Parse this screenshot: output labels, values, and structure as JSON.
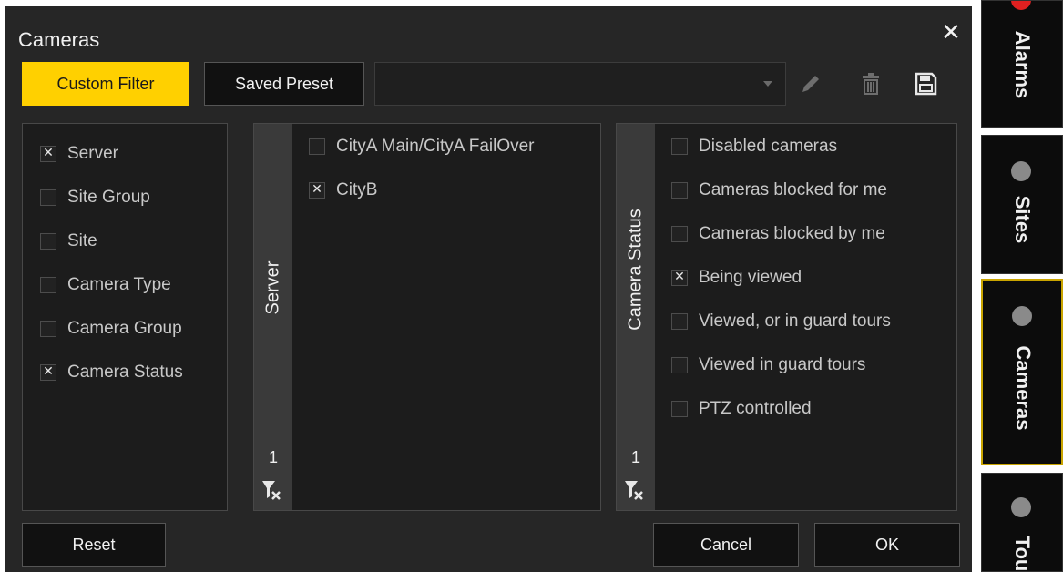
{
  "dialog": {
    "title": "Cameras",
    "close_glyph": "✕",
    "tabs": {
      "custom_filter": "Custom Filter",
      "saved_preset": "Saved Preset"
    },
    "preset_value": "",
    "icons": [
      "pencil-icon",
      "trash-icon",
      "save-icon"
    ]
  },
  "categories": [
    {
      "label": "Server",
      "checked": true
    },
    {
      "label": "Site Group",
      "checked": false
    },
    {
      "label": "Site",
      "checked": false
    },
    {
      "label": "Camera Type",
      "checked": false
    },
    {
      "label": "Camera Group",
      "checked": false
    },
    {
      "label": "Camera Status",
      "checked": true
    }
  ],
  "server_panel": {
    "title": "Server",
    "count": "1",
    "items": [
      {
        "label": "CityA Main/CityA FailOver",
        "checked": false
      },
      {
        "label": "CityB",
        "checked": true
      }
    ]
  },
  "status_panel": {
    "title": "Camera Status",
    "count": "1",
    "items": [
      {
        "label": "Disabled cameras",
        "checked": false
      },
      {
        "label": "Cameras blocked for me",
        "checked": false
      },
      {
        "label": "Cameras blocked by me",
        "checked": false
      },
      {
        "label": "Being viewed",
        "checked": true
      },
      {
        "label": "Viewed, or in guard tours",
        "checked": false
      },
      {
        "label": "Viewed in guard tours",
        "checked": false
      },
      {
        "label": "PTZ controlled",
        "checked": false
      }
    ]
  },
  "footer": {
    "reset": "Reset",
    "cancel": "Cancel",
    "ok": "OK"
  },
  "side_tabs": [
    {
      "label": "Alarms",
      "indicator": "red"
    },
    {
      "label": "Sites",
      "indicator": "gray"
    },
    {
      "label": "Cameras",
      "indicator": "gray",
      "active": true
    },
    {
      "label": "Tou",
      "indicator": "gray"
    }
  ],
  "colors": {
    "accent": "#ffd000",
    "background": "#262626",
    "panel": "#1c1c1c",
    "active_border": "#c9a400"
  }
}
